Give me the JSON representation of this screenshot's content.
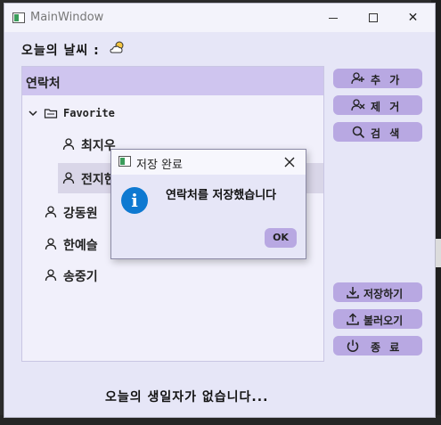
{
  "window": {
    "title": "MainWindow",
    "min_label": "",
    "max_label": "",
    "close_label": "✕"
  },
  "weather": {
    "label": "오늘의 날씨 :",
    "icon": "partly-cloudy-icon"
  },
  "contacts": {
    "header": "연락처",
    "group": "Favorite",
    "items": [
      "최지우",
      "전지현",
      "강동원",
      "한예슬",
      "송중기"
    ]
  },
  "buttons": {
    "add": "추 가",
    "remove": "제 거",
    "search": "검 색",
    "save": "저장하기",
    "load": "불러오기",
    "exit": "종 료"
  },
  "birthday_message": "오늘의 생일자가 없습니다...",
  "dialog": {
    "title": "저장 완료",
    "message": "연락처를 저장했습니다",
    "ok_label": "OK",
    "icon_glyph": "i"
  },
  "colors": {
    "accent": "#b8a8e2",
    "header": "#cfc5ef",
    "info": "#0e79d1",
    "background": "#e6e6f7"
  }
}
